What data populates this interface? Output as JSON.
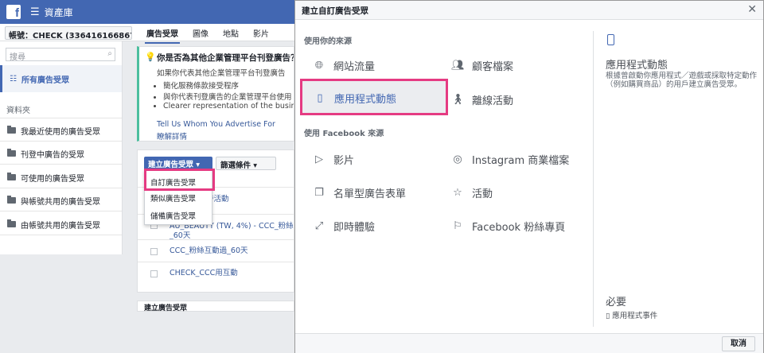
{
  "topbar": {
    "title": "資產庫",
    "menu_icon": "hamburger-icon",
    "logo_letter": "f"
  },
  "account": {
    "label": "帳號：CHECK (336416166867..."
  },
  "tabs": [
    "廣告受眾",
    "圖像",
    "地點",
    "影片"
  ],
  "sidebar": {
    "search_placeholder": "搜尋",
    "all_audiences": "所有廣告受眾",
    "folders_title": "資料夾",
    "folders": [
      "我最近使用的廣告受眾",
      "刊登中廣告的受眾",
      "可使用的廣告受眾",
      "與帳號共用的廣告受眾",
      "由帳號共用的廣告受眾"
    ]
  },
  "notice": {
    "question": "你是否為其他企業管理平台刊登廣告？",
    "desc": "如果你代表其他企業管理平台刊登廣告",
    "bullets": [
      "簡化服務條款接受程序",
      "與你代表刊登廣告的企業管理平台使用",
      "Clearer representation of the business"
    ],
    "link1": "Tell Us Whom You Advertise For",
    "link2": "瞭解詳情"
  },
  "table": {
    "create_button": "建立廣告受眾 ▾",
    "filter_button": "篩選條件 ▾",
    "rows": [
      "時活動",
      "AU_BEAUTY (TW, 4%) - CCC_粉絲",
      "_60天",
      "CCC_粉絲互動過_60天",
      "CHECK_CCC用互動"
    ]
  },
  "dropdown": {
    "items": [
      "自訂廣告受眾",
      "類似廣告受眾",
      "儲備廣告受眾"
    ]
  },
  "bottom": {
    "label": "建立廣告受眾"
  },
  "modal": {
    "title": "建立自訂廣告受眾",
    "section_own": "使用你的來源",
    "section_fb": "使用 Facebook 來源",
    "options_own": [
      {
        "label": "網站流量",
        "icon": "globe-icon"
      },
      {
        "label": "顧客檔案",
        "icon": "people-icon"
      },
      {
        "label": "應用程式動態",
        "icon": "mobile-icon"
      },
      {
        "label": "離線活動",
        "icon": "walking-icon"
      }
    ],
    "options_fb": [
      {
        "label": "影片",
        "icon": "play-icon"
      },
      {
        "label": "Instagram 商業檔案",
        "icon": "instagram-icon"
      },
      {
        "label": "名單型廣告表單",
        "icon": "form-icon"
      },
      {
        "label": "活動",
        "icon": "star-icon"
      },
      {
        "label": "即時體驗",
        "icon": "expand-icon"
      },
      {
        "label": "Facebook 粉絲專頁",
        "icon": "flag-icon"
      }
    ],
    "detail": {
      "title": "應用程式動態",
      "description": "根據曾啟動你應用程式／遊戲或採取特定動作（例如購買商品）的用戶建立廣告受眾。"
    },
    "required": "必要",
    "required_item": "應用程式事件",
    "cancel": "取消"
  }
}
